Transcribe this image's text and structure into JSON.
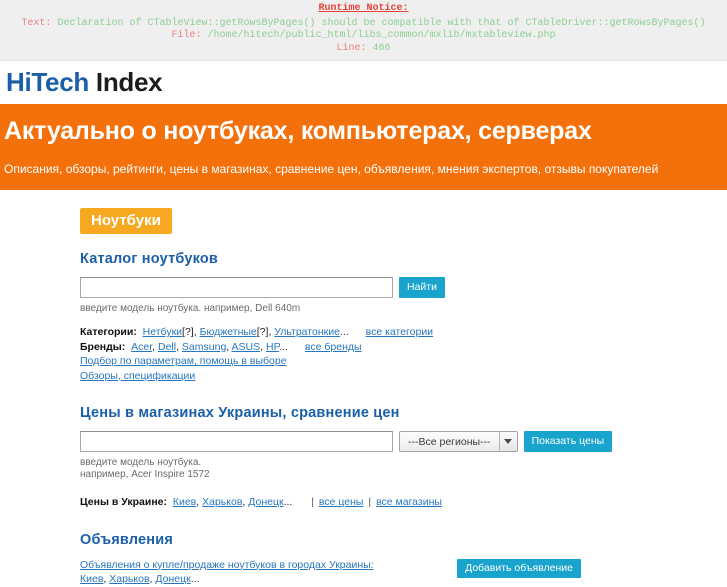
{
  "notice": {
    "title": "Runtime Notice:",
    "text_label": "Text:",
    "text_value": "Declaration of CTableView::getRowsByPages() should be compatible with that of CTableDriver::getRowsByPages()",
    "file_label": "File:",
    "file_value": "/home/hitech/public_html/libs_common/mxlib/mxtableview.php",
    "line_label": "Line:",
    "line_value": "466"
  },
  "logo": {
    "part1": "HiTech",
    "part2": "Index"
  },
  "banner": {
    "headline": "Актуально о ноутбуках, компьютерах, серверах",
    "subline": "Описания, обзоры, рейтинги, цены в магазинах, сравнение цен, объявления, мнения экспертов, отзывы покупателей"
  },
  "tab": {
    "label": "Ноутбуки"
  },
  "catalog": {
    "title": "Каталог ноутбуков",
    "search_value": "",
    "search_placeholder": "",
    "search_button": "Найти",
    "hint": "введите модель ноутбука. например, Dell 640m",
    "categories_label": "Категории:",
    "categories": [
      {
        "label": "Нетбуки",
        "hint": "[?]"
      },
      {
        "label": "Бюджетные",
        "hint": "[?]"
      },
      {
        "label": "Ультратонкие",
        "hint": ""
      }
    ],
    "categories_ellipsis": "...",
    "categories_all": "все категории",
    "brands_label": "Бренды:",
    "brands": [
      "Acer",
      "Dell",
      "Samsung",
      "ASUS",
      "HP"
    ],
    "brands_ellipsis": "...",
    "brands_all": "все бренды",
    "link_params": "Подбор по параметрам, помощь в выборе",
    "link_reviews": "Обзоры, спецификации"
  },
  "prices": {
    "title": "Цены в магазинах Украины, сравнение цен",
    "search_value": "",
    "search_placeholder": "",
    "region_selected": "---Все регионы---",
    "show_button": "Показать цены",
    "hint_line1": "введите модель ноутбука.",
    "hint_line2": "например, Acer Inspire 1572",
    "links_label": "Цены в Украине:",
    "cities": [
      "Киев",
      "Харьков",
      "Донецк"
    ],
    "cities_ellipsis": "...",
    "all_prices": "все цены",
    "all_shops": "все магазины"
  },
  "ads": {
    "title": "Объявления",
    "main_link": "Объявления о купле/продаже ноутбуков в городах Украины:",
    "cities": [
      "Киев",
      "Харьков",
      "Донецк"
    ],
    "cities_ellipsis": "...",
    "add_button": "Добавить объявление"
  },
  "colors": {
    "brand_blue": "#1b5fa8",
    "banner_orange": "#f4700a",
    "tab_amber": "#f6a821",
    "button_cyan": "#18a4cc",
    "link_blue": "#2776c0",
    "notice_red": "#e8423a",
    "notice_green": "#8fcf93"
  }
}
